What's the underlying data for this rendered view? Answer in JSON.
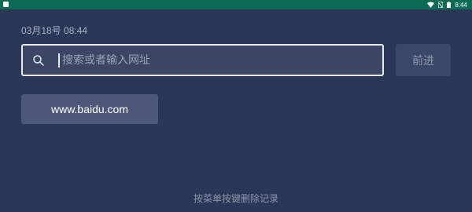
{
  "status_bar": {
    "time": "8:44",
    "icons": [
      "notification-icon",
      "wifi-icon",
      "no-sim-icon",
      "battery-icon"
    ],
    "color": "#0c6a55"
  },
  "header": {
    "date_time": "03月18号 08:44"
  },
  "search": {
    "placeholder": "搜索或者输入网址",
    "value": "",
    "icon": "search-icon"
  },
  "go_button": {
    "label": "前进"
  },
  "history": {
    "items": [
      {
        "label": "www.baidu.com"
      }
    ]
  },
  "footer": {
    "hint": "按菜单按键删除记录"
  },
  "colors": {
    "background": "#2a3756",
    "input_border": "#e7eaf0",
    "history_item_bg": "#4d5878"
  }
}
